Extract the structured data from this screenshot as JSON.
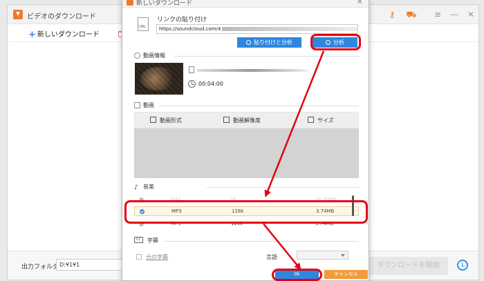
{
  "app": {
    "title": "ビデオのダウンロード",
    "new_download": "新しいダウンロード",
    "output_folder_label": "出力フォルダ：",
    "output_folder_path": "D:¥1¥1",
    "start_download": "ダウンロードを開始"
  },
  "dialog": {
    "paste_link_label": "リンクの貼り付け",
    "url_value": "https://soundcloud.com/4",
    "url_icon_text": "URL",
    "paste_analyze_label": "貼り付けと分析",
    "analyze_label": "分析",
    "video_info_label": "動画情報",
    "duration": "00:04:00",
    "video_section_label": "動画",
    "video_columns": [
      "動画形式",
      "動画解像度",
      "サイズ"
    ],
    "audio_section_label": "音楽",
    "audio_rows": [
      {
        "format": "M4A",
        "bitrate": "0k",
        "size": "00.00MB",
        "state": "faded"
      },
      {
        "format": "MP3",
        "bitrate": "128k",
        "size": "3.74MB",
        "state": "selected"
      },
      {
        "format": "MP3",
        "bitrate": "128k",
        "size": "3.74MB",
        "state": "normal"
      }
    ],
    "subtitle_section_label": "字幕",
    "cc_icon_text": "CC",
    "original_subtitle_label": "元の字幕",
    "language_label": "言語",
    "ok_label": "0k",
    "cancel_label": "キャンセル"
  },
  "colors": {
    "accent_blue": "#2e86de",
    "accent_orange": "#f39a3c",
    "annotation_red": "#e30010"
  }
}
